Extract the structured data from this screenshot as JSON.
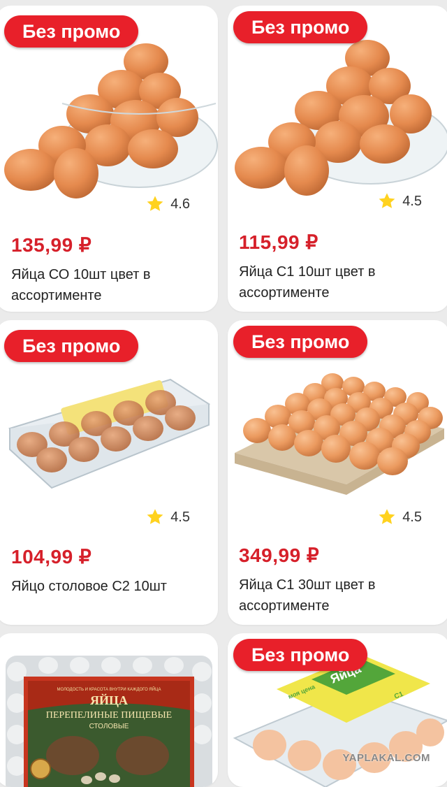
{
  "products": [
    {
      "badge": "Без промо",
      "rating": "4.6",
      "price": "135,99 ₽",
      "name": "Яйца СО 10шт цвет в ассортименте",
      "image": "eggs-bowl"
    },
    {
      "badge": "Без промо",
      "rating": "4.5",
      "price": "115,99 ₽",
      "name": "Яйца С1 10шт цвет в ассортименте",
      "image": "eggs-bowl"
    },
    {
      "badge": "Без промо",
      "rating": "4.5",
      "price": "104,99 ₽",
      "name": "Яйцо столовое С2 10шт",
      "image": "eggs-plastic-pack"
    },
    {
      "badge": "Без промо",
      "rating": "4.5",
      "price": "349,99 ₽",
      "name": "Яйца С1 30шт цвет в ассортименте",
      "image": "eggs-tray"
    },
    {
      "image": "quail-eggs-pack",
      "package_text": [
        "ЯЙЦА",
        "ПЕРЕПЕЛИНЫЕ ПИЩЕВЫЕ",
        "СТОЛОВЫЕ",
        "МОЛОДОСТЬ И КРАСОТА ВНУТРИ КАЖДОГО ЯЙЦА"
      ]
    },
    {
      "badge": "Без промо",
      "image": "eggs-moya-cena-pack",
      "package_text": [
        "моя цена",
        "Яйца",
        "С1"
      ]
    }
  ],
  "watermark": "YAPLAKAL.COM",
  "colors": {
    "badge": "#e8202a",
    "price": "#d6202a",
    "star": "#ffd21f",
    "egg": "#e58a4e"
  }
}
